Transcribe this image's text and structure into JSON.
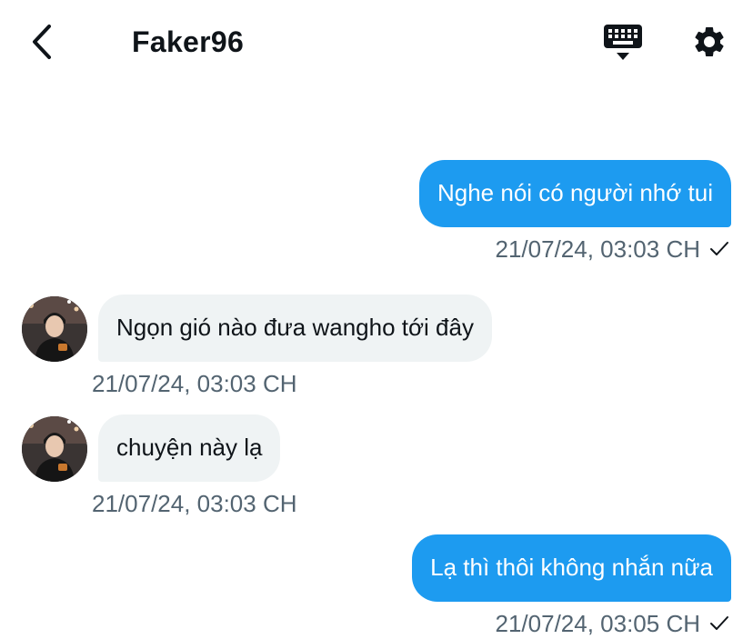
{
  "header": {
    "back_icon": "chevron-left-icon",
    "title": "Faker96",
    "keyboard_icon": "keyboard-icon",
    "settings_icon": "gear-icon"
  },
  "messages": [
    {
      "direction": "sent",
      "text": "Nghe nói có người nhớ tui",
      "time": "21/07/24, 03:03 CH",
      "status_icon": "check-icon"
    },
    {
      "direction": "received",
      "text": "Ngọn gió nào đưa wangho tới đây",
      "time": "21/07/24, 03:03 CH"
    },
    {
      "direction": "received",
      "text": "chuyện này lạ",
      "time": "21/07/24, 03:03 CH"
    },
    {
      "direction": "sent",
      "text": "Lạ thì thôi không nhắn nữa",
      "time": "21/07/24, 03:05 CH",
      "status_icon": "check-icon"
    }
  ],
  "colors": {
    "sent_bubble": "#1d9bf0",
    "received_bubble": "#eff3f4",
    "timestamp": "#536471",
    "icon": "#0f1419"
  }
}
